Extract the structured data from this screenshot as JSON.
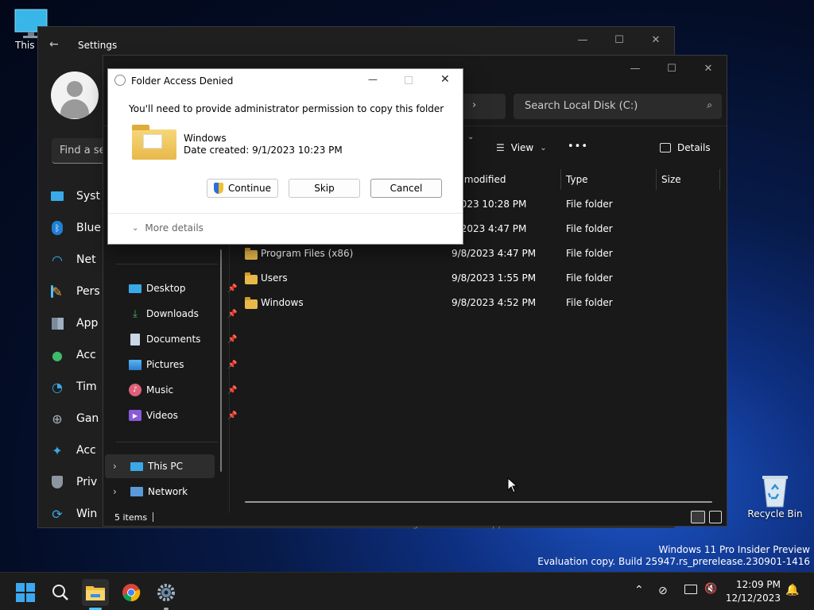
{
  "desktop": {
    "this_pc_label": "This P",
    "recycle_bin_label": "Recycle Bin",
    "watermark_line1": "Windows 11 Pro Insider Preview",
    "watermark_line2": "Evaluation copy. Build 25947.rs_prerelease.230901-1416"
  },
  "settings": {
    "title": "Settings",
    "search_placeholder": "Find a se",
    "items": [
      {
        "label": "Syst",
        "icon": "monitor-icon"
      },
      {
        "label": "Blue",
        "icon": "bluetooth-icon"
      },
      {
        "label": "Net",
        "icon": "wifi-icon"
      },
      {
        "label": "Pers",
        "icon": "brush-icon"
      },
      {
        "label": "App",
        "icon": "apps-icon"
      },
      {
        "label": "Acc",
        "icon": "person-icon"
      },
      {
        "label": "Tim",
        "icon": "globe-clock-icon"
      },
      {
        "label": "Gan",
        "icon": "gamepad-icon"
      },
      {
        "label": "Acc",
        "icon": "accessibility-icon"
      },
      {
        "label": "Priv",
        "icon": "shield-icon"
      },
      {
        "label": "Win",
        "icon": "update-icon"
      }
    ],
    "bottom_text": "Show badges on taskbar apps"
  },
  "explorer": {
    "search_placeholder": "Search Local Disk (C:)",
    "toolbar": {
      "view_label": "View",
      "details_label": "Details",
      "more_label": "•••"
    },
    "columns": {
      "date": "te modified",
      "type": "Type",
      "size": "Size"
    },
    "nav": {
      "desktop": "Desktop",
      "downloads": "Downloads",
      "documents": "Documents",
      "pictures": "Pictures",
      "music": "Music",
      "videos": "Videos",
      "this_pc": "This PC",
      "network": "Network"
    },
    "rows": [
      {
        "name": "",
        "date": "/2023 10:28 PM",
        "type": "File folder"
      },
      {
        "name": "",
        "date": "5/2023 4:47 PM",
        "type": "File folder"
      },
      {
        "name": "Program Files (x86)",
        "date": "9/8/2023 4:47 PM",
        "type": "File folder"
      },
      {
        "name": "Users",
        "date": "9/8/2023 1:55 PM",
        "type": "File folder"
      },
      {
        "name": "Windows",
        "date": "9/8/2023 4:52 PM",
        "type": "File folder"
      }
    ],
    "status": "5 items"
  },
  "dialog": {
    "title": "Folder Access Denied",
    "message": "You'll need to provide administrator permission to copy this folder",
    "folder_name": "Windows",
    "date_created": "Date created: 9/1/2023 10:23 PM",
    "continue_label": "Continue",
    "skip_label": "Skip",
    "cancel_label": "Cancel",
    "more_details_label": "More details"
  },
  "taskbar": {
    "time": "12:09 PM",
    "date": "12/12/2023"
  }
}
